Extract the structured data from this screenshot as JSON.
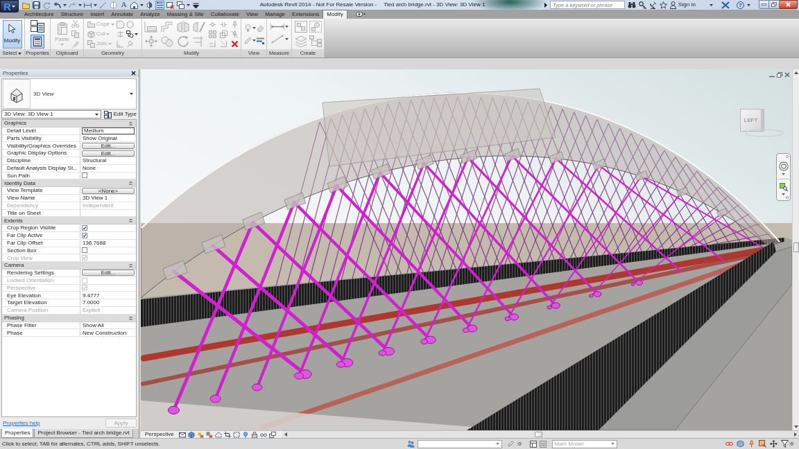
{
  "window": {
    "title": "Autodesk Revit 2014 - Not For Resale Version -",
    "document": "Tied arch bridge.rvt - 3D View: 3D View 1"
  },
  "app_button": {
    "logo": "R"
  },
  "quick_access": [
    {
      "pressed": false
    },
    {
      "pressed": false
    },
    {
      "pressed": false
    },
    {
      "pressed": false,
      "dropdown": true
    },
    {
      "pressed": false,
      "dropdown": true
    },
    {
      "pressed": false,
      "dropdown": true
    },
    {
      "pressed": false
    },
    {
      "pressed": false
    },
    {
      "label": "A",
      "pressed": false
    },
    {
      "pressed": false,
      "dropdown": true
    },
    {
      "pressed": false
    },
    {
      "pressed": true
    },
    {
      "pressed": false
    },
    {
      "pressed": false,
      "dropdown": true
    },
    {
      "pressed": false
    }
  ],
  "search": {
    "placeholder": "Type a keyword or phrase"
  },
  "account": {
    "label": "Sign In"
  },
  "help": {
    "glyph": "?"
  },
  "tabs": [
    {
      "label": "Architecture",
      "selected": false
    },
    {
      "label": "Structure",
      "selected": false
    },
    {
      "label": "Insert",
      "selected": false
    },
    {
      "label": "Annotate",
      "selected": false
    },
    {
      "label": "Analyze",
      "selected": false
    },
    {
      "label": "Massing & Site",
      "selected": false
    },
    {
      "label": "Collaborate",
      "selected": false
    },
    {
      "label": "View",
      "selected": false
    },
    {
      "label": "Manage",
      "selected": false
    },
    {
      "label": "Extensions",
      "selected": false
    },
    {
      "label": "Modify",
      "selected": true
    }
  ],
  "ribbon": {
    "panels": [
      {
        "label": "Select",
        "dropdown": true,
        "tools": [
          {
            "label": "Modify",
            "selected": true
          }
        ]
      },
      {
        "label": "Properties",
        "pressed": true
      },
      {
        "label": "Clipboard",
        "tools": [
          {
            "label": "Paste",
            "disabled": true
          }
        ]
      },
      {
        "label": "Geometry",
        "tools": [
          {
            "label": "Cope",
            "disabled": true
          },
          {
            "label": "Cut",
            "disabled": true
          },
          {
            "label": "Join",
            "disabled": true
          }
        ]
      },
      {
        "label": "Modify"
      },
      {
        "label": "View"
      },
      {
        "label": "Measure"
      },
      {
        "label": "Create"
      }
    ]
  },
  "properties": {
    "title": "Properties",
    "type_selector": {
      "label": "3D View"
    },
    "instance": {
      "value": "3D View: 3D View 1"
    },
    "edit_type": {
      "label": "Edit Type"
    },
    "sections": [
      {
        "label": "Graphics",
        "expanded": true,
        "rows": [
          {
            "name": "Detail Level",
            "kind": "input",
            "value": "Medium",
            "disabled": false
          },
          {
            "name": "Parts Visibility",
            "kind": "text",
            "value": "Show Original",
            "disabled": false
          },
          {
            "name": "Visibility/Graphics Overrides",
            "kind": "button",
            "value": "Edit...",
            "disabled": false
          },
          {
            "name": "Graphic Display Options",
            "kind": "button",
            "value": "Edit...",
            "disabled": false
          },
          {
            "name": "Discipline",
            "kind": "text",
            "value": "Structural",
            "disabled": false
          },
          {
            "name": "Default Analysis Display St...",
            "kind": "text",
            "value": "None",
            "disabled": false
          },
          {
            "name": "Sun Path",
            "kind": "checkbox",
            "checked": false,
            "disabled": false
          }
        ]
      },
      {
        "label": "Identity Data",
        "expanded": true,
        "rows": [
          {
            "name": "View Template",
            "kind": "button",
            "value": "<None>",
            "disabled": false
          },
          {
            "name": "View Name",
            "kind": "text",
            "value": "3D View 1",
            "disabled": false
          },
          {
            "name": "Dependency",
            "kind": "text",
            "value": "Independent",
            "disabled": true
          },
          {
            "name": "Title on Sheet",
            "kind": "text",
            "disabled": false
          }
        ]
      },
      {
        "label": "Extents",
        "expanded": true,
        "rows": [
          {
            "name": "Crop Region Visible",
            "kind": "checkbox",
            "checked": true,
            "disabled": false
          },
          {
            "name": "Far Clip Active",
            "kind": "checkbox",
            "checked": true,
            "disabled": false
          },
          {
            "name": "Far Clip Offset",
            "kind": "text",
            "value": "136.7688",
            "disabled": false
          },
          {
            "name": "Section Box",
            "kind": "checkbox",
            "checked": false,
            "disabled": false
          },
          {
            "name": "Crop View",
            "kind": "checkbox",
            "checked": true,
            "disabled": true
          }
        ]
      },
      {
        "label": "Camera",
        "expanded": true,
        "rows": [
          {
            "name": "Rendering Settings",
            "kind": "button",
            "value": "Edit...",
            "disabled": false
          },
          {
            "name": "Locked Orientation",
            "kind": "checkbox",
            "checked": false,
            "disabled": true
          },
          {
            "name": "Perspective",
            "kind": "checkbox",
            "checked": true,
            "disabled": true
          },
          {
            "name": "Eye Elevation",
            "kind": "text",
            "value": "9.4777",
            "disabled": false
          },
          {
            "name": "Target Elevation",
            "kind": "text",
            "value": "7.0000",
            "disabled": false
          },
          {
            "name": "Camera Position",
            "kind": "text",
            "value": "Explicit",
            "disabled": true
          }
        ]
      },
      {
        "label": "Phasing",
        "expanded": true,
        "rows": [
          {
            "name": "Phase Filter",
            "kind": "text",
            "value": "Show All",
            "disabled": false
          },
          {
            "name": "Phase",
            "kind": "text",
            "value": "New Construction",
            "disabled": false
          }
        ]
      }
    ],
    "help_link": "Properties help",
    "apply": {
      "label": "Apply",
      "disabled": true
    }
  },
  "browser_tabs": [
    {
      "label": "Properties",
      "selected": true
    },
    {
      "label": "Project Browser - Tied arch bridge.rvt",
      "selected": false
    }
  ],
  "viewport": {
    "viewcube_face": "LEFT",
    "view_bar": {
      "label": "Perspective"
    }
  },
  "status_bar": {
    "message": "Click to select, TAB for alternates, CTRL adds, SHIFT unselects.",
    "editable_count": ":0",
    "design_option": {
      "value": "Main Model",
      "disabled": true
    },
    "filter_count": ":0"
  }
}
